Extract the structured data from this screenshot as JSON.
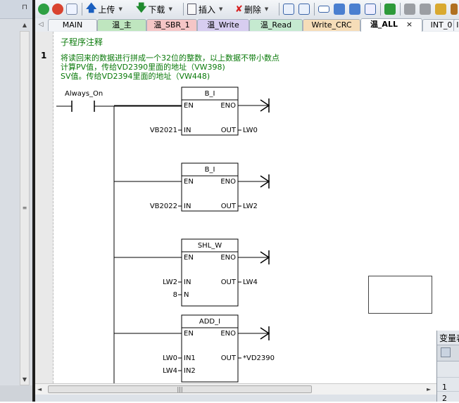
{
  "toolbar": {
    "upload_label": "上传",
    "download_label": "下载",
    "insert_label": "插入",
    "delete_label": "删除"
  },
  "tabs": [
    {
      "label": "MAIN",
      "color": "#f2f4f7"
    },
    {
      "label": "温_主",
      "color": "#bfe6bf"
    },
    {
      "label": "温_SBR_1",
      "color": "#f5c6c6"
    },
    {
      "label": "温_Write",
      "color": "#d7cdf0"
    },
    {
      "label": "温_Read",
      "color": "#c5ead0"
    },
    {
      "label": "Write_CRC",
      "color": "#f6ddb8"
    },
    {
      "label": "温_ALL",
      "color": "#ffffff"
    },
    {
      "label": "INT_0",
      "color": "#f2f4f7"
    },
    {
      "label": "IN",
      "color": "#f2f4f7"
    }
  ],
  "active_tab_close": "×",
  "editor": {
    "subroutine_comment": "子程序注释",
    "network_number": "1",
    "comment_lines": [
      "将读回来的数据进行拼成一个32位的整数，以上数据不带小数点",
      "计算PV值，传给VD2390里面的地址（VW398)",
      "SV值。传给VD2394里面的地址（VW448)"
    ],
    "contact_label": "Always_On",
    "blocks": [
      {
        "title": "B_I",
        "en": "EN",
        "eno": "ENO",
        "inputs": [
          {
            "pin": "IN",
            "operand": "VB2021"
          }
        ],
        "out_pin": "OUT",
        "out_operand": "LW0"
      },
      {
        "title": "B_I",
        "en": "EN",
        "eno": "ENO",
        "inputs": [
          {
            "pin": "IN",
            "operand": "VB2022"
          }
        ],
        "out_pin": "OUT",
        "out_operand": "LW2"
      },
      {
        "title": "SHL_W",
        "en": "EN",
        "eno": "ENO",
        "inputs": [
          {
            "pin": "IN",
            "operand": "LW2"
          },
          {
            "pin": "N",
            "operand": "8"
          }
        ],
        "out_pin": "OUT",
        "out_operand": "LW4"
      },
      {
        "title": "ADD_I",
        "en": "EN",
        "eno": "ENO",
        "inputs": [
          {
            "pin": "IN1",
            "operand": "LW0"
          },
          {
            "pin": "IN2",
            "operand": "LW4"
          }
        ],
        "out_pin": "OUT",
        "out_operand": "*VD2390"
      }
    ]
  },
  "variable_table": {
    "title": "变量表",
    "rows": [
      "1",
      "2"
    ]
  }
}
